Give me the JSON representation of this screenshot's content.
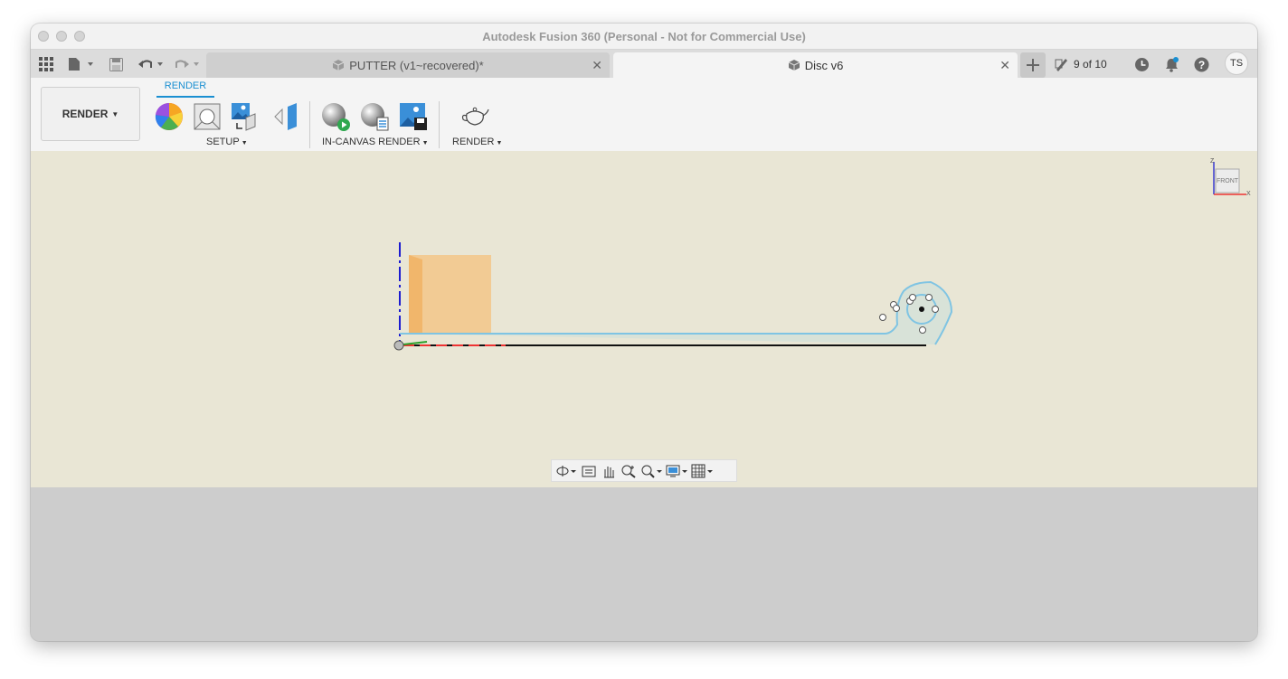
{
  "window": {
    "title": "Autodesk Fusion 360 (Personal - Not for Commercial Use)"
  },
  "tabbar": {
    "tabs": [
      {
        "label": "PUTTER (v1~recovered)*",
        "active": false
      },
      {
        "label": "Disc v6",
        "active": true
      }
    ],
    "job_status": "9 of 10",
    "user_initials": "TS"
  },
  "toolbar": {
    "workspace": "RENDER",
    "active_tab": "RENDER",
    "groups": {
      "setup": "SETUP",
      "in_canvas_render": "IN-CANVAS RENDER",
      "render": "RENDER"
    }
  },
  "viewcube": {
    "face": "FRONT",
    "axis_z": "Z",
    "axis_x": "X"
  },
  "colors": {
    "accent": "#1a8fd1",
    "viewport_bg": "#e9e6d5",
    "sketch_blue": "#7fc4e3",
    "body_orange": "#f4c27d"
  },
  "icons": {
    "apps": "grid-icon",
    "file": "file-icon",
    "save": "save-icon",
    "undo": "undo-icon",
    "redo": "redo-icon",
    "new_tab": "plus-icon",
    "job_status": "job-status-icon",
    "history": "clock-icon",
    "notifications": "bell-icon",
    "help": "help-icon"
  }
}
